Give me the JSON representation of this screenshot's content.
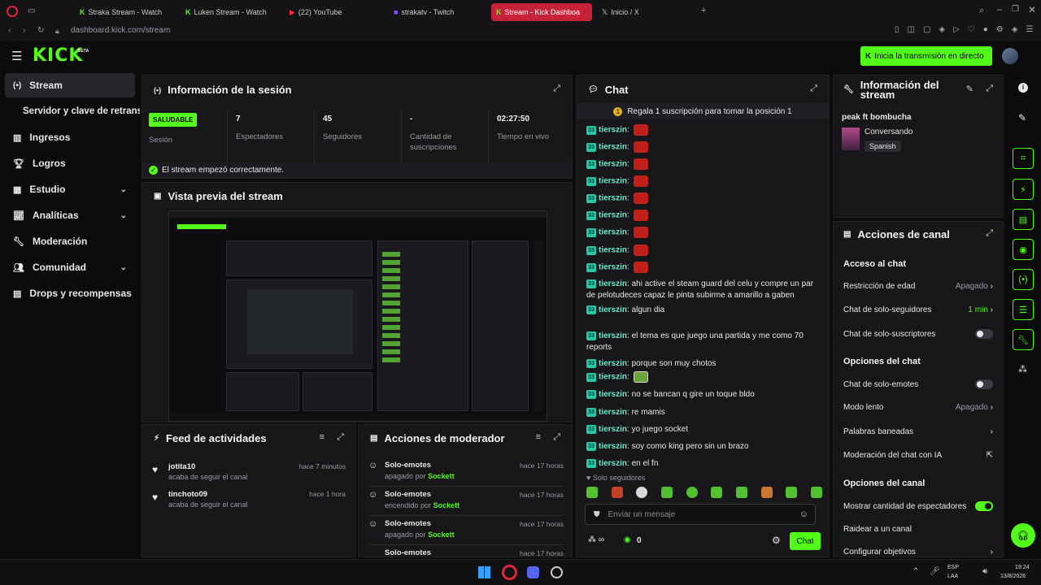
{
  "browser": {
    "tabs": [
      {
        "label": "Straka Stream - Watch",
        "active": false
      },
      {
        "label": "Luken Stream - Watch",
        "active": false
      },
      {
        "label": "(22) YouTube",
        "active": false
      },
      {
        "label": "strakatv - Twitch",
        "active": false
      },
      {
        "label": "Stream - Kick Dashboa",
        "active": true
      },
      {
        "label": "Inicio / X",
        "active": false
      }
    ],
    "url": "dashboard.kick.com/stream"
  },
  "header": {
    "logo": "KICK",
    "logo_tag": "BETA",
    "start_stream_label": "Inicia la transmisión en directo"
  },
  "sidebar": {
    "items": [
      {
        "label": "Stream",
        "icon": "stream-icon"
      },
      {
        "label": "Servidor y clave de retransm",
        "icon": ""
      },
      {
        "label": "Ingresos",
        "icon": "chart-icon"
      },
      {
        "label": "Logros",
        "icon": "trophy-icon"
      },
      {
        "label": "Estudio",
        "icon": "studio-icon"
      },
      {
        "label": "Analíticas",
        "icon": "analytics-icon"
      },
      {
        "label": "Moderación",
        "icon": "wrench-icon"
      },
      {
        "label": "Comunidad",
        "icon": "community-icon"
      },
      {
        "label": "Drops y recompensas",
        "icon": "drops-icon"
      }
    ]
  },
  "session": {
    "title": "Información de la sesión",
    "status_badge": "SALUDABLE",
    "status_label": "Sesión",
    "stats": [
      {
        "value": "7",
        "label": "Espectadores"
      },
      {
        "value": "45",
        "label": "Seguidores"
      },
      {
        "value": "-",
        "label": "Cantidad de suscripciones"
      },
      {
        "value": "02:27:50",
        "label": "Tiempo en vivo"
      }
    ],
    "ok_message": "El stream empezó correctamente."
  },
  "preview": {
    "title": "Vista previa del stream"
  },
  "feed": {
    "title": "Feed de actividades",
    "items": [
      {
        "user": "jotita10",
        "action": "acaba de seguir el canal",
        "time": "hace 7 minutos"
      },
      {
        "user": "tinchoto09",
        "action": "acaba de seguir el canal",
        "time": "hace 1 hora"
      }
    ]
  },
  "mod": {
    "title": "Acciones de moderador",
    "items": [
      {
        "title": "Solo-emotes",
        "state": "apagado por",
        "by": "Sockett",
        "time": "hace 17 horas"
      },
      {
        "title": "Solo-emotes",
        "state": "encendido por",
        "by": "Sockett",
        "time": "hace 17 horas"
      },
      {
        "title": "Solo-emotes",
        "state": "apagado por",
        "by": "Sockett",
        "time": "hace 17 horas"
      },
      {
        "title": "Solo-emotes",
        "state": "",
        "by": "",
        "time": "hace 17 horas"
      }
    ]
  },
  "chat": {
    "title": "Chat",
    "pinned": "Regala 1 suscripción para tomar la posición 1",
    "messages": [
      {
        "badge": "33",
        "user": "tierszin",
        "text": "",
        "emote": "red"
      },
      {
        "badge": "33",
        "user": "tierszin",
        "text": "",
        "emote": "red"
      },
      {
        "badge": "33",
        "user": "tierszin",
        "text": "",
        "emote": "red"
      },
      {
        "badge": "33",
        "user": "tierszin",
        "text": "",
        "emote": "red"
      },
      {
        "badge": "33",
        "user": "tierszin",
        "text": "",
        "emote": "red"
      },
      {
        "badge": "33",
        "user": "tierszin",
        "text": "",
        "emote": "red"
      },
      {
        "badge": "33",
        "user": "tierszin",
        "text": "",
        "emote": "red"
      },
      {
        "badge": "33",
        "user": "tierszin",
        "text": "",
        "emote": "red"
      },
      {
        "badge": "33",
        "user": "tierszin",
        "text": "",
        "emote": "red"
      },
      {
        "badge": "33",
        "user": "tierszin",
        "text": "ahi active el steam guard del celu y compre un par de pelotudeces capaz le pinta subirme a amarillo a gaben",
        "emote": ""
      },
      {
        "badge": "33",
        "user": "tierszin",
        "text": "algun dia",
        "emote": ""
      },
      {
        "badge": "33",
        "user": "tierszin",
        "text": "el tema es que juego una partida y me como 70 reports",
        "emote": ""
      },
      {
        "badge": "33",
        "user": "tierszin",
        "text": "porque son muy chotos",
        "emote": ""
      },
      {
        "badge": "33",
        "user": "tierszin",
        "text": "",
        "emote": "frog"
      },
      {
        "badge": "33",
        "user": "tierszin",
        "text": "no se bancan q gire un toque bldo",
        "emote": ""
      },
      {
        "badge": "33",
        "user": "tierszin",
        "text": "re mamis",
        "emote": ""
      },
      {
        "badge": "33",
        "user": "tierszin",
        "text": "yo juego socket",
        "emote": ""
      },
      {
        "badge": "33",
        "user": "tierszin",
        "text": "soy como king pero sin un brazo",
        "emote": ""
      },
      {
        "badge": "33",
        "user": "tierszin",
        "text": "en el fn",
        "emote": ""
      }
    ],
    "followers_only": "Solo seguidores",
    "input_placeholder": "Enviar un mensaje",
    "points": "0",
    "send_label": "Chat"
  },
  "stream_info": {
    "title": "Información del stream",
    "stream_title": "peak ft bombucha",
    "category": "Conversando",
    "language": "Spanish"
  },
  "channel_actions": {
    "title": "Acciones de canal",
    "chat_access_heading": "Acceso al chat",
    "age_restriction": {
      "label": "Restricción de edad",
      "value": "Apagado"
    },
    "followers_only": {
      "label": "Chat de solo-seguidores",
      "value": "1 min"
    },
    "subs_only": {
      "label": "Chat de solo-suscriptores"
    },
    "chat_options_heading": "Opciones del chat",
    "emotes_only": {
      "label": "Chat de solo-emotes"
    },
    "slow_mode": {
      "label": "Modo lento",
      "value": "Apagado"
    },
    "banned_words": {
      "label": "Palabras baneadas"
    },
    "ai_mod": {
      "label": "Moderación del chat con IA"
    },
    "channel_options_heading": "Opciones del canal",
    "show_viewers": {
      "label": "Mostrar cantidad de espectadores"
    },
    "raid": {
      "label": "Raidear a un canal"
    },
    "goals": {
      "label": "Configurar objetivos"
    }
  },
  "taskbar": {
    "lang": "ESP",
    "lang2": "LAA",
    "time": "19:24",
    "date": "13/8/2026"
  },
  "colors": {
    "accent": "#53fc18",
    "active_tab": "#c8223a"
  }
}
